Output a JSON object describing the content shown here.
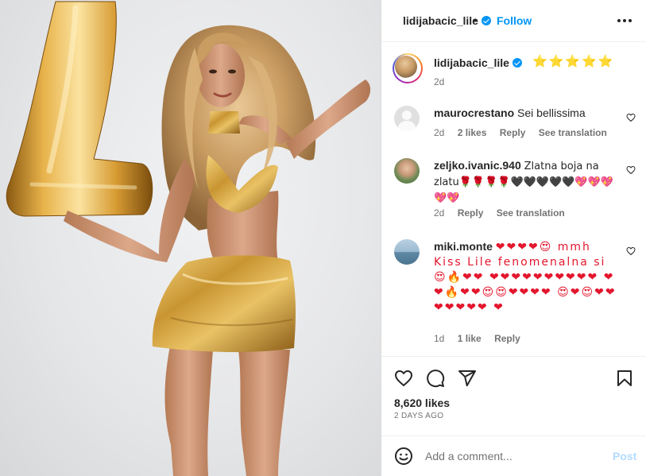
{
  "photo": {
    "alt_icon": "photo-woman-gold-dress-balloon-L"
  },
  "header": {
    "username": "lidijabacic_lile",
    "separator": "•",
    "follow_label": "Follow"
  },
  "caption": {
    "username": "lidijabacic_lile",
    "text": "⭐⭐⭐⭐⭐",
    "time": "2d"
  },
  "comments": [
    {
      "username": "maurocrestano",
      "text": "Sei bellissima",
      "time": "2d",
      "likes": "2 likes",
      "reply": "Reply",
      "translate": "See translation"
    },
    {
      "username": "zeljko.ivanic.940",
      "text": "Zlatna boja na zlatu🌹🌹🌹🌹🖤🖤🖤🖤🖤💖💖💖💖💖",
      "time": "2d",
      "reply": "Reply",
      "translate": "See translation"
    },
    {
      "username": "miki.monte",
      "text": "❤❤❤❤😍 mmh Kiss Lile fenomenalna si 😍🔥❤❤ ❤❤❤❤❤❤❤❤❤❤ ❤❤🔥❤❤😍😍❤❤❤❤ 😍❤😍❤❤❤❤❤❤❤ ❤",
      "time": "1d",
      "likes": "1 like",
      "reply": "Reply"
    }
  ],
  "actions": {
    "likes": "8,620 likes",
    "date": "2 DAYS AGO"
  },
  "add_comment": {
    "placeholder": "Add a comment...",
    "post_label": "Post"
  },
  "colors": {
    "accent": "#0095f6",
    "post_disabled": "#b3dbff",
    "gold": "#c9962a"
  }
}
